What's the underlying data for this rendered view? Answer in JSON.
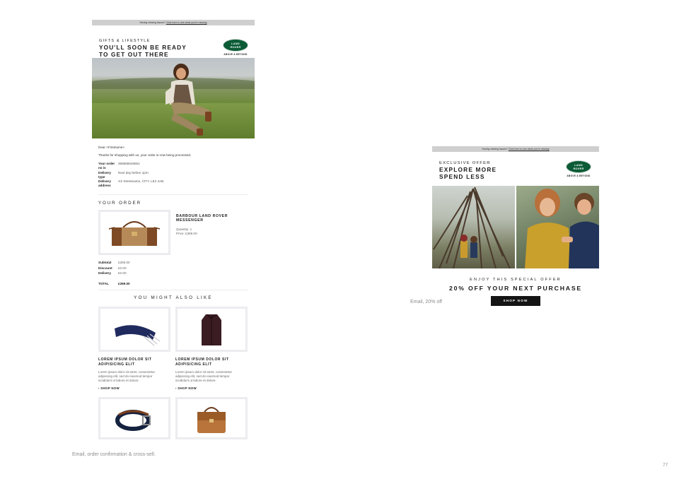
{
  "email_order": {
    "topbar_text": "Having viewing issues?",
    "topbar_link": "Click here to see what you're missing",
    "kicker": "GIFTS & LIFESTYLE",
    "headline_line1": "YOU'LL SOON BE READY",
    "headline_line2": "TO GET OUT THERE",
    "logo_line1": "LAND",
    "logo_line2": "ROVER",
    "logo_tagline": "ABOVE & BEYOND",
    "greeting": "Dear <Firstname>",
    "thanks": "Thanks for shopping with us, your order is now being processed.",
    "order_info": [
      {
        "label": "Your order no is",
        "value": "356666645552"
      },
      {
        "label": "Delivery type",
        "value": "Next day before 1pm"
      },
      {
        "label": "Delivery address",
        "value": "XX Streetname, CITY, LE2 2AB"
      }
    ],
    "your_order_title": "YOUR ORDER",
    "product_name_line1": "BARBOUR LAND ROVER",
    "product_name_line2": "MESSENGER",
    "product_quantity": "Quantity: 1",
    "product_price": "Price: £369.00",
    "totals": [
      {
        "label": "Subtotal",
        "value": "£369.00"
      },
      {
        "label": "Discount",
        "value": "£0.00"
      },
      {
        "label": "Delivery",
        "value": "£0.00"
      }
    ],
    "total_label": "TOTAL",
    "total_value": "£369.00",
    "also_like_title": "YOU MIGHT ALSO LIKE",
    "cross_sell": [
      {
        "title_line1": "LOREM IPSUM DOLOR SIT",
        "title_line2": "ADIPISICING ELIT",
        "desc_line1": "Lorem ipsum dolor sit amet, consectetur",
        "desc_line2": "adipiscing elit, sed do eiusmod tempor",
        "desc_line3": "incididunt ut labore et dolore.",
        "shop": "› SHOP NOW"
      },
      {
        "title_line1": "LOREM IPSUM DOLOR SIT",
        "title_line2": "ADIPISICING ELIT",
        "desc_line1": "Lorem ipsum dolor sit amet, consectetur",
        "desc_line2": "adipiscing elit, sed do eiusmod tempor",
        "desc_line3": "incididunt ut labore et dolore.",
        "shop": "› SHOP NOW"
      }
    ]
  },
  "email_offer": {
    "topbar_text": "Having viewing issues?",
    "topbar_link": "Click here to see what you're missing",
    "kicker": "EXCLUSIVE OFFER",
    "headline_line1": "EXPLORE MORE",
    "headline_line2": "SPEND LESS",
    "logo_line1": "LAND",
    "logo_line2": "ROVER",
    "logo_tagline": "ABOVE & BEYOND",
    "enjoy": "ENJOY THIS SPECIAL OFFER",
    "offer": "20% OFF YOUR NEXT PURCHASE",
    "cta": "SHOP NOW"
  },
  "captions": {
    "offer_caption": "Email, 20% off",
    "order_caption": "Email, order confirmation & cross-sell.",
    "page_number": "77"
  }
}
